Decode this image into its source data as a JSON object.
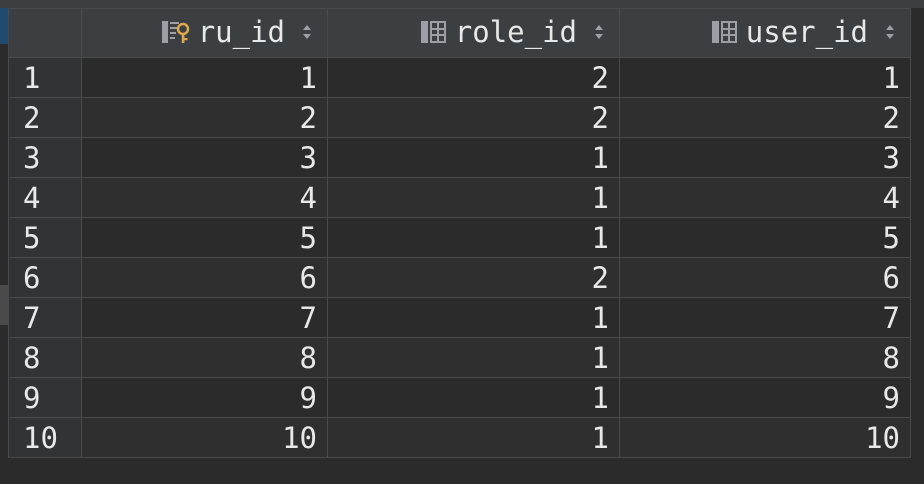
{
  "table": {
    "columns": [
      {
        "label": "ru_id",
        "icon": "primary-key-column-icon",
        "key_color": "#e0a84a"
      },
      {
        "label": "role_id",
        "icon": "column-icon"
      },
      {
        "label": "user_id",
        "icon": "column-icon"
      }
    ],
    "rows": [
      {
        "num": "1",
        "ru_id": "1",
        "role_id": "2",
        "user_id": "1"
      },
      {
        "num": "2",
        "ru_id": "2",
        "role_id": "2",
        "user_id": "2"
      },
      {
        "num": "3",
        "ru_id": "3",
        "role_id": "1",
        "user_id": "3"
      },
      {
        "num": "4",
        "ru_id": "4",
        "role_id": "1",
        "user_id": "4"
      },
      {
        "num": "5",
        "ru_id": "5",
        "role_id": "1",
        "user_id": "5"
      },
      {
        "num": "6",
        "ru_id": "6",
        "role_id": "2",
        "user_id": "6"
      },
      {
        "num": "7",
        "ru_id": "7",
        "role_id": "1",
        "user_id": "7"
      },
      {
        "num": "8",
        "ru_id": "8",
        "role_id": "1",
        "user_id": "8"
      },
      {
        "num": "9",
        "ru_id": "9",
        "role_id": "1",
        "user_id": "9"
      },
      {
        "num": "10",
        "ru_id": "10",
        "role_id": "1",
        "user_id": "10"
      }
    ]
  },
  "colors": {
    "background": "#2b2b2b",
    "header": "#3c3f41",
    "grid_line": "#4a4a4a",
    "text": "#e8e8e8",
    "accent": "#204a6e"
  }
}
